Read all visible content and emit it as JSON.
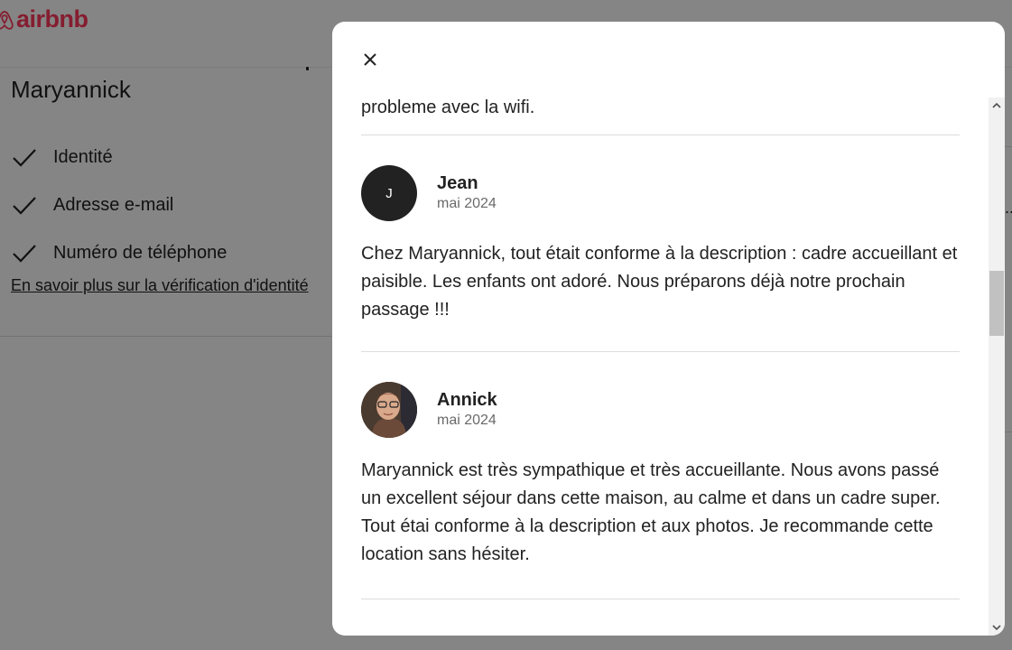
{
  "brand": {
    "name": "airbnb",
    "color": "#ff385c"
  },
  "host": {
    "name": "Maryannick",
    "verifications": [
      {
        "label": "Identité",
        "icon": "checkmark-icon"
      },
      {
        "label": "Adresse e-mail",
        "icon": "checkmark-icon"
      },
      {
        "label": "Numéro de téléphone",
        "icon": "checkmark-icon"
      }
    ],
    "learn_more_link": "En savoir plus sur la vérification d'identité"
  },
  "background_fragment": {
    "right_edge_text": "..."
  },
  "modal": {
    "close_icon": "close-icon",
    "previous_review_tail": "probleme avec la wifi.",
    "reviews": [
      {
        "reviewer": "Jean",
        "date": "mai 2024",
        "avatar_initial": "J",
        "avatar_type": "initial",
        "text": "Chez Maryannick, tout était conforme à la description : cadre accueillant et paisible. Les enfants ont adoré. Nous préparons déjà notre prochain passage !!!"
      },
      {
        "reviewer": "Annick",
        "date": "mai 2024",
        "avatar_type": "photo",
        "text": "Maryannick est très sympathique et très accueillante. Nous avons passé un excellent séjour dans cette maison, au calme et dans un cadre super. Tout étai conforme à la description et aux photos. Je recommande cette location sans hésiter."
      }
    ]
  },
  "colors": {
    "text": "#222222",
    "muted": "#6a6a6a",
    "divider": "#dddddd",
    "overlay": "rgba(0,0,0,0.48)"
  }
}
